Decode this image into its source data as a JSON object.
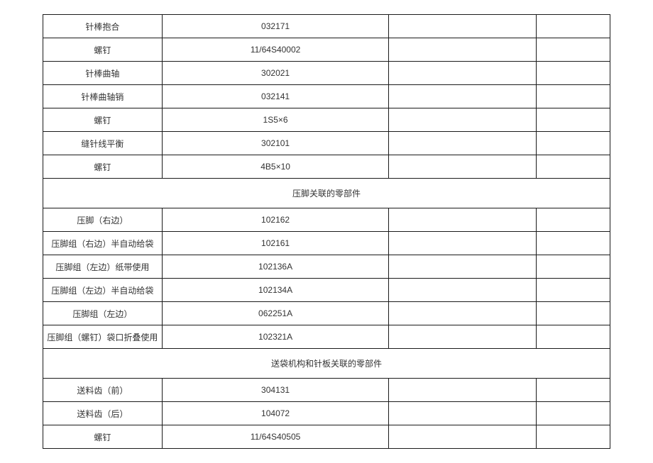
{
  "rows": [
    {
      "type": "data",
      "c1": "针棒抱合",
      "c2": "032171",
      "c3": "",
      "c4": ""
    },
    {
      "type": "data",
      "c1": "螺钉",
      "c2": "11/64S40002",
      "c3": "",
      "c4": ""
    },
    {
      "type": "data",
      "c1": "针棒曲轴",
      "c2": "302021",
      "c3": "",
      "c4": ""
    },
    {
      "type": "data",
      "c1": "针棒曲轴销",
      "c2": "032141",
      "c3": "",
      "c4": ""
    },
    {
      "type": "data",
      "c1": "螺钉",
      "c2": "1S5×6",
      "c3": "",
      "c4": ""
    },
    {
      "type": "data",
      "c1": "缝针线平衡",
      "c2": "302101",
      "c3": "",
      "c4": ""
    },
    {
      "type": "data",
      "c1": "螺钉",
      "c2": "4B5×10",
      "c3": "",
      "c4": ""
    },
    {
      "type": "header",
      "label": "压脚关联的零部件"
    },
    {
      "type": "data",
      "c1": "压脚（右边）",
      "c2": "102162",
      "c3": "",
      "c4": ""
    },
    {
      "type": "data",
      "c1": "压脚组（右边）半自动给袋",
      "c2": "102161",
      "c3": "",
      "c4": ""
    },
    {
      "type": "data",
      "c1": "压脚组（左边）纸带使用",
      "c2": "102136A",
      "c3": "",
      "c4": ""
    },
    {
      "type": "data",
      "c1": "压脚组（左边）半自动给袋",
      "c2": "102134A",
      "c3": "",
      "c4": ""
    },
    {
      "type": "data",
      "c1": "压脚组（左边）",
      "c2": "062251A",
      "c3": "",
      "c4": ""
    },
    {
      "type": "data",
      "c1": "压脚组（螺钉）袋口折叠使用",
      "c2": "102321A",
      "c3": "",
      "c4": ""
    },
    {
      "type": "header",
      "label": "送袋机构和针板关联的零部件"
    },
    {
      "type": "data",
      "c1": "送料齿（前）",
      "c2": "304131",
      "c3": "",
      "c4": ""
    },
    {
      "type": "data",
      "c1": "送料齿（后）",
      "c2": "104072",
      "c3": "",
      "c4": ""
    },
    {
      "type": "data",
      "c1": "螺钉",
      "c2": "11/64S40505",
      "c3": "",
      "c4": ""
    }
  ]
}
